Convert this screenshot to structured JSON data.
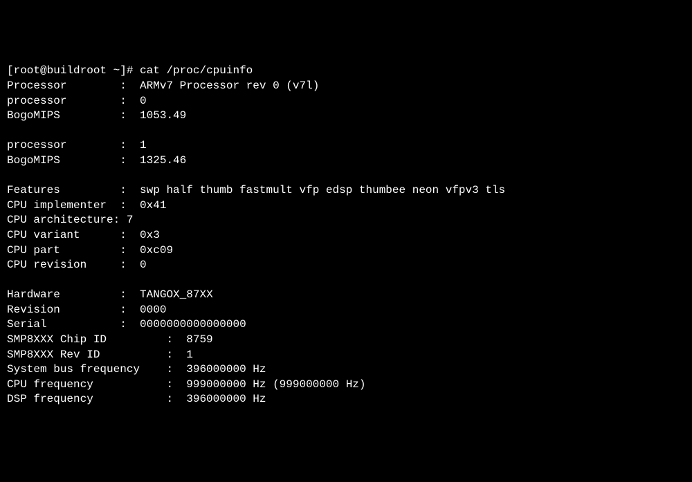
{
  "prompt": {
    "user_host": "[root@buildroot ~]#",
    "command": "cat /proc/cpuinfo"
  },
  "lines": [
    {
      "key": "Processor",
      "colon_col": 18,
      "value": "ARMv7 Processor rev 0 (v7l)",
      "key_pad": 17
    },
    {
      "key": "processor",
      "colon_col": 18,
      "value": "0",
      "key_pad": 17
    },
    {
      "key": "BogoMIPS",
      "colon_col": 18,
      "value": "1053.49",
      "key_pad": 17
    },
    {
      "blank": true
    },
    {
      "key": "processor",
      "colon_col": 18,
      "value": "1",
      "key_pad": 17
    },
    {
      "key": "BogoMIPS",
      "colon_col": 18,
      "value": "1325.46",
      "key_pad": 17
    },
    {
      "blank": true
    },
    {
      "key": "Features",
      "colon_col": 18,
      "value": "swp half thumb fastmult vfp edsp thumbee neon vfpv3 tls",
      "key_pad": 17
    },
    {
      "key": "CPU implementer",
      "colon_col": 18,
      "value": "0x41",
      "key_pad": 17
    },
    {
      "key": "CPU architecture",
      "colon_col": 17,
      "value": "7",
      "key_pad": 16,
      "gap_after_colon": 1
    },
    {
      "key": "CPU variant",
      "colon_col": 18,
      "value": "0x3",
      "key_pad": 17
    },
    {
      "key": "CPU part",
      "colon_col": 18,
      "value": "0xc09",
      "key_pad": 17
    },
    {
      "key": "CPU revision",
      "colon_col": 18,
      "value": "0",
      "key_pad": 17
    },
    {
      "blank": true
    },
    {
      "key": "Hardware",
      "colon_col": 18,
      "value": "TANGOX_87XX",
      "key_pad": 17
    },
    {
      "key": "Revision",
      "colon_col": 18,
      "value": "0000",
      "key_pad": 17
    },
    {
      "key": "Serial",
      "colon_col": 18,
      "value": "0000000000000000",
      "key_pad": 17
    },
    {
      "key": "SMP8XXX Chip ID",
      "colon_col": 25,
      "value": "8759",
      "key_pad": 24
    },
    {
      "key": "SMP8XXX Rev ID",
      "colon_col": 25,
      "value": "1",
      "key_pad": 24
    },
    {
      "key": "System bus frequency",
      "colon_col": 25,
      "value": "396000000 Hz",
      "key_pad": 24
    },
    {
      "key": "CPU frequency",
      "colon_col": 25,
      "value": "999000000 Hz (999000000 Hz)",
      "key_pad": 24
    },
    {
      "key": "DSP frequency",
      "colon_col": 25,
      "value": "396000000 Hz",
      "key_pad": 24
    }
  ]
}
